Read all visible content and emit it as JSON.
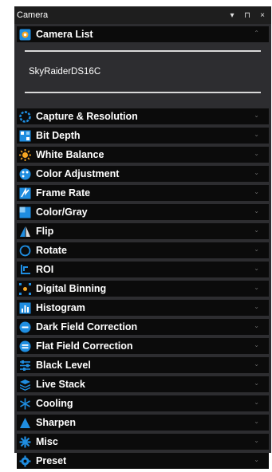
{
  "panel": {
    "title": "Camera"
  },
  "title_actions": {
    "menu": "▾",
    "pin": "⊓",
    "close": "×"
  },
  "camera_list": {
    "label": "Camera List",
    "icon": "camera-list-icon",
    "expanded": true,
    "chevron": "⌃",
    "selected_camera": "SkyRaiderDS16C"
  },
  "sections": [
    {
      "label": "Capture & Resolution",
      "icon": "capture-resolution-icon",
      "chevron": "⌄"
    },
    {
      "label": "Bit Depth",
      "icon": "bit-depth-icon",
      "chevron": "⌄"
    },
    {
      "label": "White Balance",
      "icon": "white-balance-icon",
      "chevron": "⌄"
    },
    {
      "label": "Color Adjustment",
      "icon": "color-adjustment-icon",
      "chevron": "⌄"
    },
    {
      "label": "Frame Rate",
      "icon": "frame-rate-icon",
      "chevron": "⌄"
    },
    {
      "label": "Color/Gray",
      "icon": "color-gray-icon",
      "chevron": "⌄"
    },
    {
      "label": "Flip",
      "icon": "flip-icon",
      "chevron": "⌄"
    },
    {
      "label": "Rotate",
      "icon": "rotate-icon",
      "chevron": "⌄"
    },
    {
      "label": "ROI",
      "icon": "roi-icon",
      "chevron": "⌄"
    },
    {
      "label": "Digital Binning",
      "icon": "digital-binning-icon",
      "chevron": "⌄"
    },
    {
      "label": "Histogram",
      "icon": "histogram-icon",
      "chevron": "⌄"
    },
    {
      "label": "Dark Field Correction",
      "icon": "dark-field-correction-icon",
      "chevron": "⌄"
    },
    {
      "label": "Flat Field Correction",
      "icon": "flat-field-correction-icon",
      "chevron": "⌄"
    },
    {
      "label": "Black Level",
      "icon": "black-level-icon",
      "chevron": "⌄"
    },
    {
      "label": "Live Stack",
      "icon": "live-stack-icon",
      "chevron": "⌄"
    },
    {
      "label": "Cooling",
      "icon": "cooling-icon",
      "chevron": "⌄"
    },
    {
      "label": "Sharpen",
      "icon": "sharpen-icon",
      "chevron": "⌄"
    },
    {
      "label": "Misc",
      "icon": "misc-icon",
      "chevron": "⌄"
    },
    {
      "label": "Preset",
      "icon": "preset-icon",
      "chevron": "⌄"
    }
  ],
  "colors": {
    "panel_bg": "#2d2d30",
    "titlebar_bg": "#1e1e1e",
    "section_bg": "#0b0b0b",
    "icon_accent": "#1f8de0",
    "text": "#ffffff"
  }
}
